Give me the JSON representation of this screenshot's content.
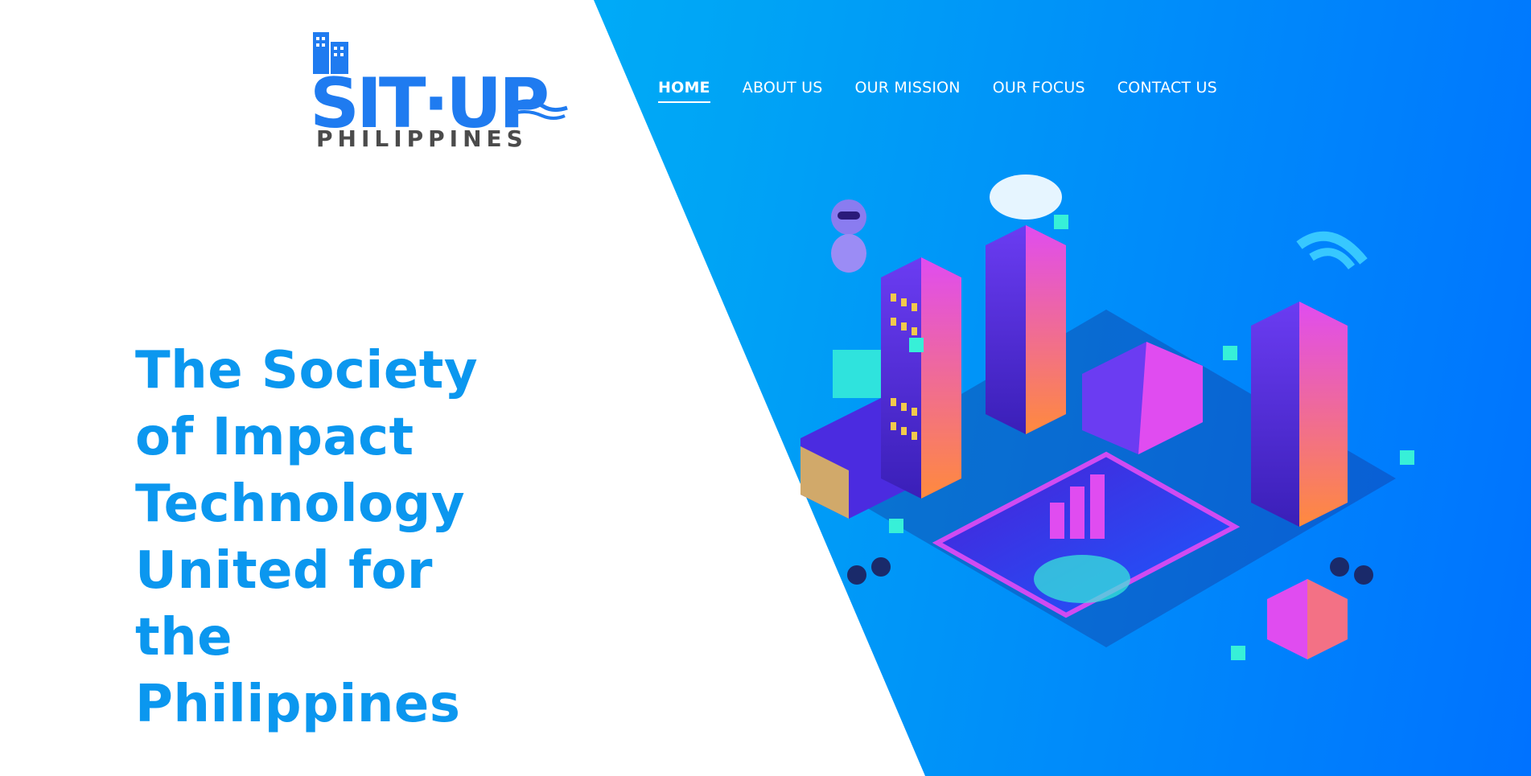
{
  "logo": {
    "main_text": "SIT·UP",
    "sub_text": "PHILIPPINES",
    "colors": {
      "main": "#1f7bf0",
      "sub": "#4b4b4b"
    }
  },
  "nav": {
    "items": [
      {
        "label": "HOME",
        "active": true
      },
      {
        "label": "ABOUT US",
        "active": false
      },
      {
        "label": "OUR MISSION",
        "active": false
      },
      {
        "label": "OUR FOCUS",
        "active": false
      },
      {
        "label": "CONTACT US",
        "active": false
      }
    ]
  },
  "hero": {
    "headline_lines": [
      "The Society",
      "of Impact",
      "Technology",
      "United for",
      "the",
      "Philippines"
    ],
    "illustration_icon": "isometric-smart-city-illustration"
  },
  "colors": {
    "headline": "#0b97ef",
    "hero_gradient_start": "#00c2ff",
    "hero_gradient_end": "#0072ff",
    "accent_pink": "#e04cf0",
    "accent_purple": "#5b2ee0",
    "accent_cyan": "#37f0d8"
  }
}
